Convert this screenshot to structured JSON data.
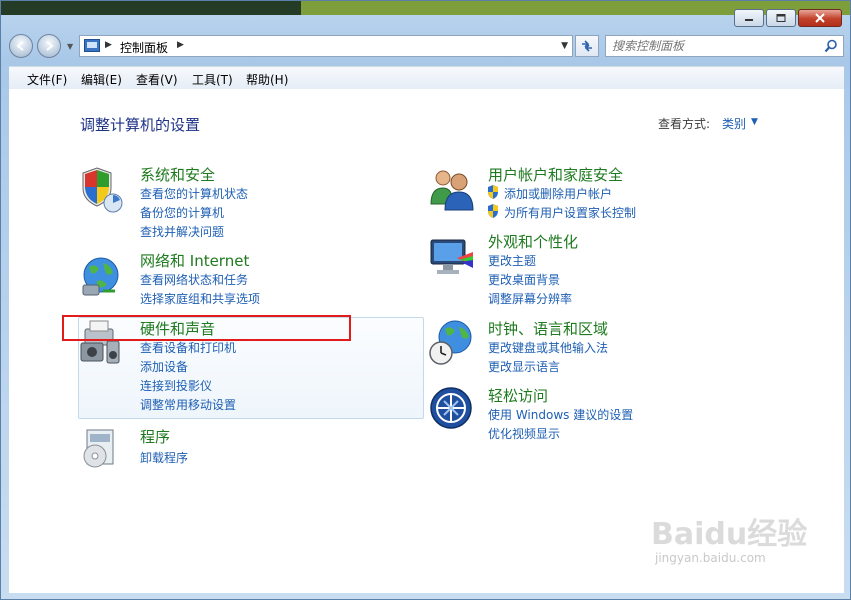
{
  "address": {
    "crumb": "控制面板"
  },
  "search": {
    "placeholder": "搜索控制面板"
  },
  "menu": [
    "文件(F)",
    "编辑(E)",
    "查看(V)",
    "工具(T)",
    "帮助(H)"
  ],
  "main": {
    "heading": "调整计算机的设置",
    "view_by_label": "查看方式:",
    "view_by_value": "类别"
  },
  "categories": {
    "system": {
      "title": "系统和安全",
      "links": [
        "查看您的计算机状态",
        "备份您的计算机",
        "查找并解决问题"
      ]
    },
    "network": {
      "title": "网络和 Internet",
      "links": [
        "查看网络状态和任务",
        "选择家庭组和共享选项"
      ]
    },
    "hardware": {
      "title": "硬件和声音",
      "links": [
        "查看设备和打印机",
        "添加设备",
        "连接到投影仪",
        "调整常用移动设置"
      ]
    },
    "programs": {
      "title": "程序",
      "links": [
        "卸载程序"
      ]
    },
    "users": {
      "title": "用户帐户和家庭安全",
      "links": [
        "添加或删除用户帐户",
        "为所有用户设置家长控制"
      ]
    },
    "appearance": {
      "title": "外观和个性化",
      "links": [
        "更改主题",
        "更改桌面背景",
        "调整屏幕分辨率"
      ]
    },
    "clock": {
      "title": "时钟、语言和区域",
      "links": [
        "更改键盘或其他输入法",
        "更改显示语言"
      ]
    },
    "ease": {
      "title": "轻松访问",
      "links": [
        "使用 Windows 建议的设置",
        "优化视频显示"
      ]
    }
  },
  "watermark": {
    "logo": "Baidu经验",
    "url": "jingyan.baidu.com"
  },
  "colors": {
    "category_title": "#1e7a1e",
    "link": "#1e5fb4",
    "highlight_box": "#e21b1b"
  }
}
